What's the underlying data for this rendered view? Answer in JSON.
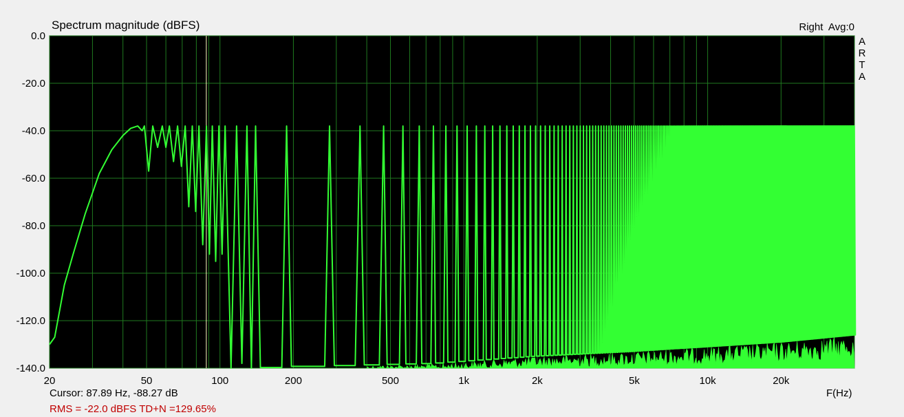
{
  "header": {
    "title": "Spectrum magnitude (dBFS)",
    "channel": "Right",
    "avg": "Avg:0"
  },
  "brand": [
    "A",
    "R",
    "T",
    "A"
  ],
  "footer": {
    "cursor": "Cursor: 87.89 Hz, -88.27 dB",
    "rms": "RMS =  -22.0 dBFS   TD+N =129.65%",
    "x_unit": "F(Hz)"
  },
  "colors": {
    "plot_bg": "#000000",
    "grid": "#1f7a1f",
    "trace": "#33ff33",
    "cursor_line": "#ffffc0",
    "rms_text": "#c00000"
  },
  "chart_data": {
    "type": "line",
    "title": "Spectrum magnitude (dBFS)",
    "xlabel": "F(Hz)",
    "ylabel": "",
    "xscale": "log",
    "xlim": [
      20,
      40000
    ],
    "ylim": [
      -140,
      0
    ],
    "grid": true,
    "x_ticks": [
      {
        "value": 20,
        "label": "20"
      },
      {
        "value": 50,
        "label": "50"
      },
      {
        "value": 100,
        "label": "100"
      },
      {
        "value": 200,
        "label": "200"
      },
      {
        "value": 500,
        "label": "500"
      },
      {
        "value": 1000,
        "label": "1k"
      },
      {
        "value": 2000,
        "label": "2k"
      },
      {
        "value": 5000,
        "label": "5k"
      },
      {
        "value": 10000,
        "label": "10k"
      },
      {
        "value": 20000,
        "label": "20k"
      }
    ],
    "y_ticks": [
      {
        "value": 0,
        "label": "0.0"
      },
      {
        "value": -20,
        "label": "-20.0"
      },
      {
        "value": -40,
        "label": "-40.0"
      },
      {
        "value": -60,
        "label": "-60.0"
      },
      {
        "value": -80,
        "label": "-80.0"
      },
      {
        "value": -100,
        "label": "-100.0"
      },
      {
        "value": -120,
        "label": "-120.0"
      },
      {
        "value": -140,
        "label": "-140.0"
      }
    ],
    "cursor": {
      "x": 87.89,
      "y": -88.27
    },
    "low_envelope": [
      [
        20,
        -130
      ],
      [
        21,
        -127
      ],
      [
        23,
        -105
      ],
      [
        25,
        -92
      ],
      [
        28,
        -75
      ],
      [
        32,
        -58
      ],
      [
        36,
        -48
      ],
      [
        40,
        -42
      ],
      [
        43,
        -39
      ],
      [
        46,
        -38
      ]
    ],
    "fundamental": 46.9,
    "harmonic_peak_db": -38,
    "lobes": [
      {
        "x": 49,
        "min": -40
      },
      {
        "x": 53,
        "min": -57
      },
      {
        "x": 58,
        "min": -47
      },
      {
        "x": 62,
        "min": -47
      },
      {
        "x": 67,
        "min": -53
      },
      {
        "x": 72,
        "min": -55
      },
      {
        "x": 77,
        "min": -72
      },
      {
        "x": 82,
        "min": -74
      },
      {
        "x": 88,
        "min": -88
      },
      {
        "x": 93,
        "min": -92
      },
      {
        "x": 99,
        "min": -95
      },
      {
        "x": 105,
        "min": -92
      },
      {
        "x": 117,
        "min": -140
      },
      {
        "x": 129,
        "min": -138
      },
      {
        "x": 140,
        "min": -140
      }
    ],
    "noise_floor": [
      [
        150,
        -140
      ],
      [
        800,
        -138
      ],
      [
        2000,
        -135
      ],
      [
        5000,
        -133
      ],
      [
        10000,
        -131
      ],
      [
        20000,
        -129
      ],
      [
        40000,
        -126
      ]
    ]
  }
}
